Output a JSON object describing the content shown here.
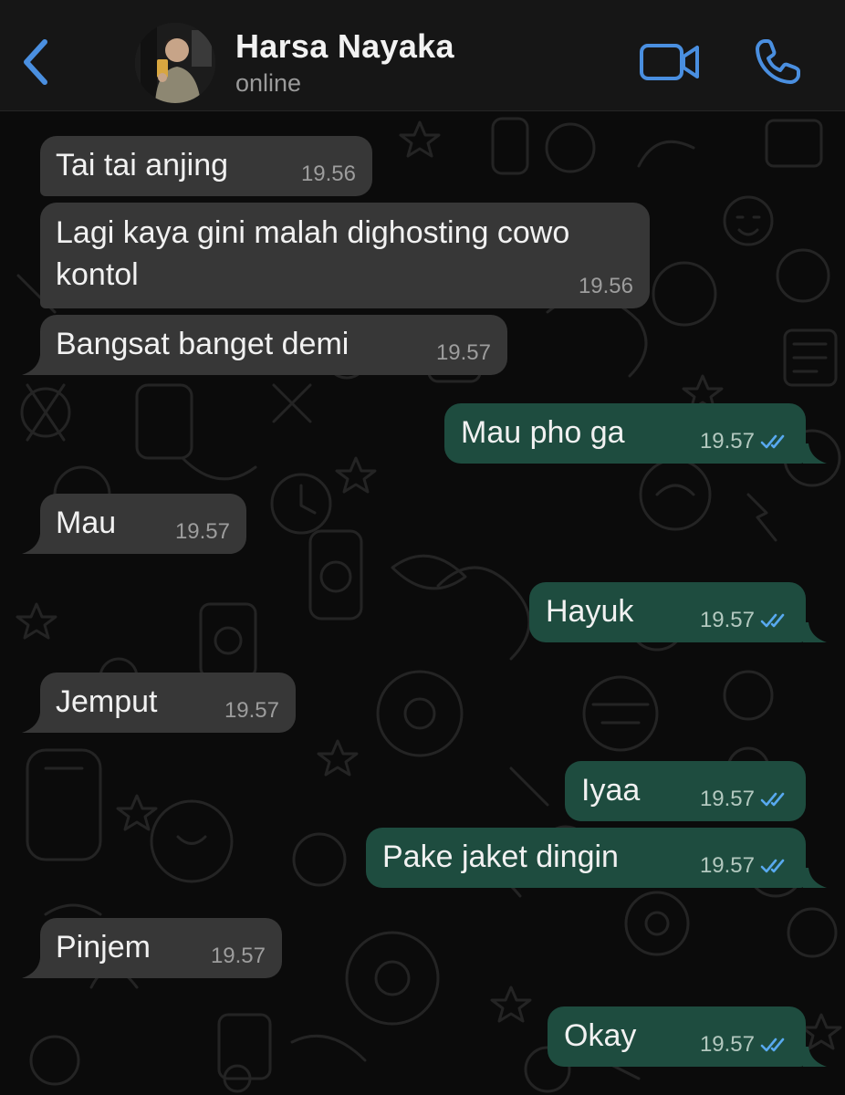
{
  "header": {
    "back_icon": "chevron-left-icon",
    "contact_name": "Harsa Nayaka",
    "status": "online",
    "video_icon": "video-camera-icon",
    "call_icon": "phone-icon"
  },
  "colors": {
    "accent_blue": "#4a8fe0",
    "incoming_bubble": "#373737",
    "outgoing_bubble": "#1e4c3f",
    "read_receipt": "#58a9ef",
    "background": "#0b0b0b",
    "header_bg": "#161616"
  },
  "messages": [
    {
      "direction": "incoming",
      "text": "Tai tai anjing",
      "time": "19.56"
    },
    {
      "direction": "incoming",
      "text": "Lagi kaya gini malah dighosting cowo kontol",
      "time": "19.56"
    },
    {
      "direction": "incoming",
      "text": "Bangsat banget demi",
      "time": "19.57"
    },
    {
      "direction": "outgoing",
      "text": "Mau pho ga",
      "time": "19.57",
      "status": "read"
    },
    {
      "direction": "incoming",
      "text": "Mau",
      "time": "19.57"
    },
    {
      "direction": "outgoing",
      "text": "Hayuk",
      "time": "19.57",
      "status": "read"
    },
    {
      "direction": "incoming",
      "text": "Jemput",
      "time": "19.57"
    },
    {
      "direction": "outgoing",
      "text": "Iyaa",
      "time": "19.57",
      "status": "read"
    },
    {
      "direction": "outgoing",
      "text": "Pake jaket dingin",
      "time": "19.57",
      "status": "read"
    },
    {
      "direction": "incoming",
      "text": "Pinjem",
      "time": "19.57"
    },
    {
      "direction": "outgoing",
      "text": "Okay",
      "time": "19.57",
      "status": "read"
    }
  ]
}
